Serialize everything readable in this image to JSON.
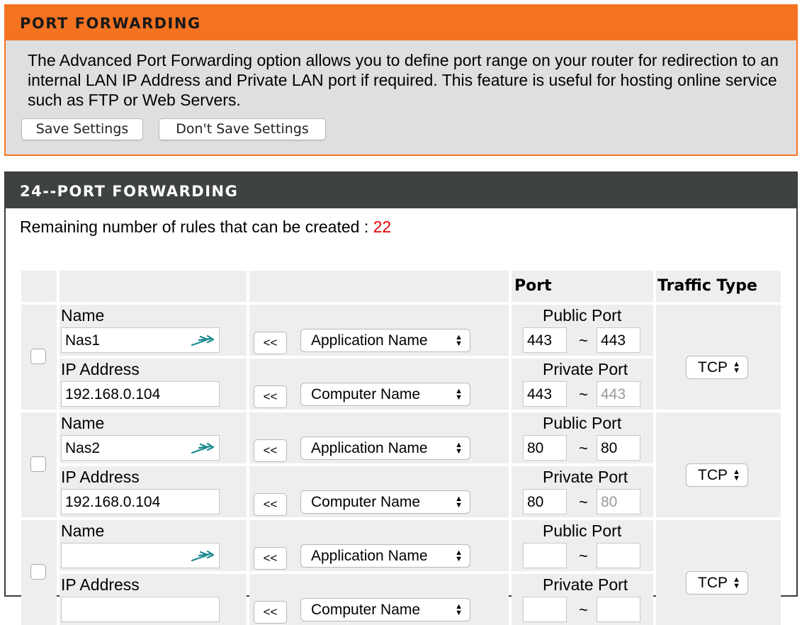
{
  "header": {
    "title": "PORT FORWARDING"
  },
  "intro": {
    "description": "The Advanced Port Forwarding option allows you to define port range on your router for redirection to an internal LAN IP Address and Private LAN port if required. This feature is useful for hosting online service such as FTP or Web Servers.",
    "save_label": "Save Settings",
    "dont_save_label": "Don't Save Settings"
  },
  "forwarding": {
    "title": "24--PORT FORWARDING",
    "remaining_label": "Remaining number of rules that can be created : ",
    "remaining_value": "22",
    "remaining_color": "#e00000"
  },
  "table": {
    "header_port": "Port",
    "header_traffic": "Traffic Type",
    "name_label": "Name",
    "ip_label": "IP Address",
    "public_port_label": "Public Port",
    "private_port_label": "Private Port",
    "copy_button": "<<",
    "app_select": "Application Name",
    "computer_select": "Computer Name",
    "tilde": "~"
  },
  "rules": [
    {
      "name": "Nas1",
      "ip": "192.168.0.104",
      "public_start": "443",
      "public_end": "443",
      "private_start": "443",
      "private_end": "443",
      "traffic": "TCP",
      "checked": false
    },
    {
      "name": "Nas2",
      "ip": "192.168.0.104",
      "public_start": "80",
      "public_end": "80",
      "private_start": "80",
      "private_end": "80",
      "traffic": "TCP",
      "checked": false
    },
    {
      "name": "",
      "ip": "",
      "public_start": "",
      "public_end": "",
      "private_start": "",
      "private_end": "",
      "traffic": "TCP",
      "checked": false
    }
  ],
  "icons": {
    "name_field_icon": "arrow-icon",
    "select_icon": "up-down-arrows-icon"
  },
  "colors": {
    "accent": "#f47321",
    "dark_header": "#3f4243",
    "cell_bg": "#eeeeee"
  }
}
